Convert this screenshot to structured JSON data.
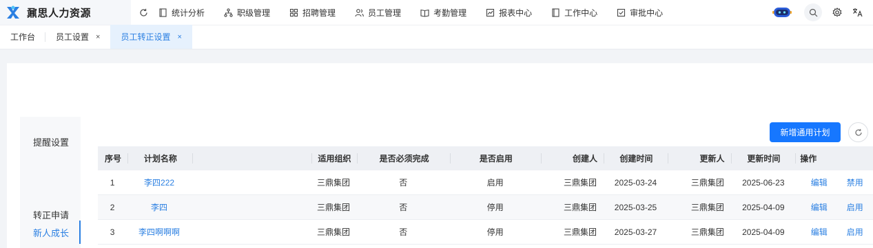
{
  "app": {
    "brand": "鼐思人力资源"
  },
  "nav": [
    {
      "label": "统计分析",
      "icon": "file-icon"
    },
    {
      "label": "职级管理",
      "icon": "org-tree-icon"
    },
    {
      "label": "招聘管理",
      "icon": "grid-icon"
    },
    {
      "label": "员工管理",
      "icon": "users-icon"
    },
    {
      "label": "考勤管理",
      "icon": "book-icon"
    },
    {
      "label": "报表中心",
      "icon": "chart-icon"
    },
    {
      "label": "工作中心",
      "icon": "file-icon"
    },
    {
      "label": "审批中心",
      "icon": "checkbox-icon"
    }
  ],
  "tabs": [
    {
      "label": "工作台",
      "closable": false,
      "active": false
    },
    {
      "label": "员工设置",
      "closable": true,
      "active": false
    },
    {
      "label": "员工转正设置",
      "closable": true,
      "active": true
    }
  ],
  "tab_close_glyph": "×",
  "sidemenu": [
    {
      "label": "提醒设置",
      "active": false
    },
    {
      "label": "新人成长",
      "active": true
    },
    {
      "label": "转正申请",
      "active": false
    }
  ],
  "toolbar": {
    "add_label": "新增通用计划"
  },
  "table": {
    "headers": {
      "seq": "序号",
      "name": "计划名称",
      "org": "适用组织",
      "must": "是否必须完成",
      "enable": "是否启用",
      "creator": "创建人",
      "ctime": "创建时间",
      "updater": "更新人",
      "utime": "更新时间",
      "ops": "操作"
    },
    "rows": [
      {
        "seq": "1",
        "name": "李四222",
        "org": "三鼎集团",
        "must": "否",
        "enable": "启用",
        "creator": "三鼎集团",
        "ctime": "2025-03-24",
        "updater": "三鼎集团",
        "utime": "2025-06-23",
        "edit": "编辑",
        "toggle": "禁用"
      },
      {
        "seq": "2",
        "name": "李四",
        "org": "三鼎集团",
        "must": "否",
        "enable": "停用",
        "creator": "三鼎集团",
        "ctime": "2025-03-25",
        "updater": "三鼎集团",
        "utime": "2025-04-09",
        "edit": "编辑",
        "toggle": "启用"
      },
      {
        "seq": "3",
        "name": "李四啊啊啊",
        "org": "三鼎集团",
        "must": "否",
        "enable": "停用",
        "creator": "三鼎集团",
        "ctime": "2025-03-27",
        "updater": "三鼎集团",
        "utime": "2025-04-09",
        "edit": "编辑",
        "toggle": "启用"
      }
    ]
  },
  "colors": {
    "accent": "#1677ff",
    "link": "#2a7fe2",
    "active_tab_bg": "#e6f1fd"
  }
}
